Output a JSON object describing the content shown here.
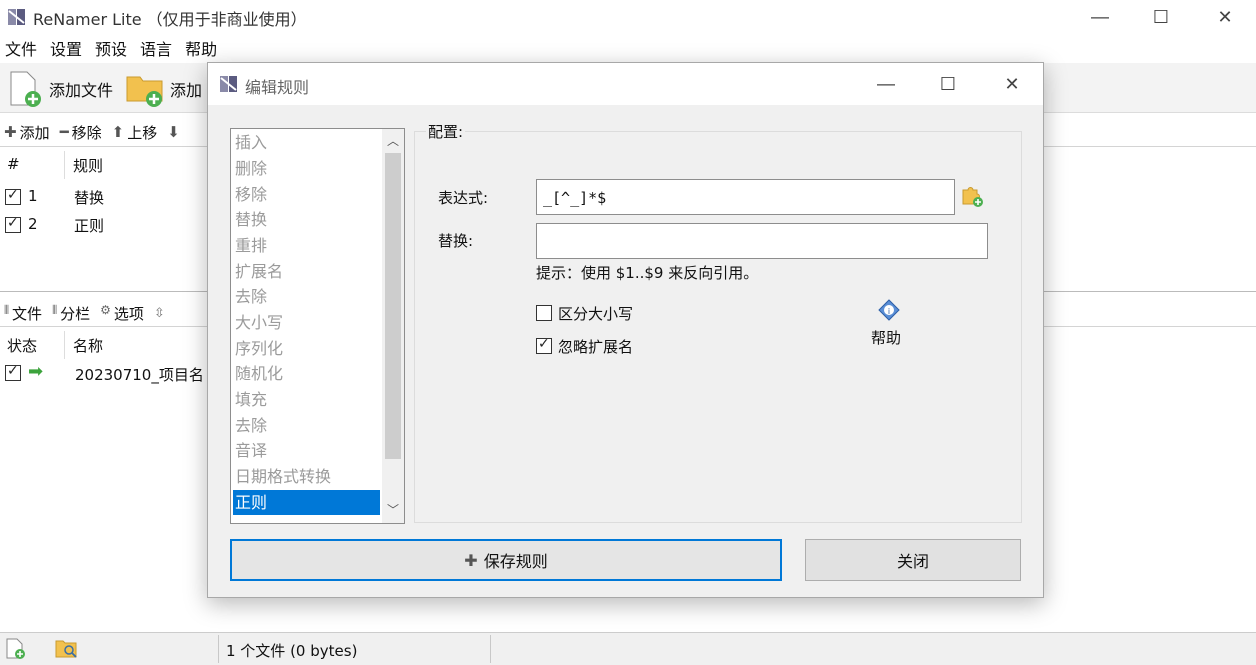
{
  "main_window": {
    "title": "ReNamer Lite  （仅用于非商业使用）",
    "menu": [
      "文件",
      "设置",
      "预设",
      "语言",
      "帮助"
    ],
    "toolbar": {
      "add_files": "添加文件",
      "add_folder": "添加"
    },
    "rules_toolbar": {
      "add": "添加",
      "remove": "移除",
      "up": "上移"
    },
    "rules_table": {
      "headers": [
        "#",
        "规则"
      ],
      "rows": [
        {
          "num": "1",
          "name": "替换",
          "checked": true
        },
        {
          "num": "2",
          "name": "正则",
          "checked": true
        }
      ]
    },
    "files_toolbar": {
      "files": "文件",
      "columns": "分栏",
      "options": "选项"
    },
    "files_table": {
      "headers": [
        "状态",
        "名称"
      ],
      "rows": [
        {
          "name": "20230710_项目名",
          "checked": true
        }
      ]
    },
    "status_text": "1 个文件 (0 bytes)"
  },
  "dialog": {
    "title": "编辑规则",
    "rule_types": [
      "插入",
      "删除",
      "移除",
      "替换",
      "重排",
      "扩展名",
      "去除",
      "大小写",
      "序列化",
      "随机化",
      "填充",
      "去除",
      "音译",
      "日期格式转换",
      "正则"
    ],
    "selected_rule": "正则",
    "config_label": "配置:",
    "expression_label": "表达式:",
    "expression_value": "_[^_]*$",
    "replace_label": "替换:",
    "replace_value": "",
    "hint": "提示：使用 $1..$9 来反向引用。",
    "case_sensitive_label": "区分大小写",
    "case_sensitive": false,
    "ignore_ext_label": "忽略扩展名",
    "ignore_ext": true,
    "help_label": "帮助",
    "save_button": "保存规则",
    "close_button": "关闭"
  }
}
